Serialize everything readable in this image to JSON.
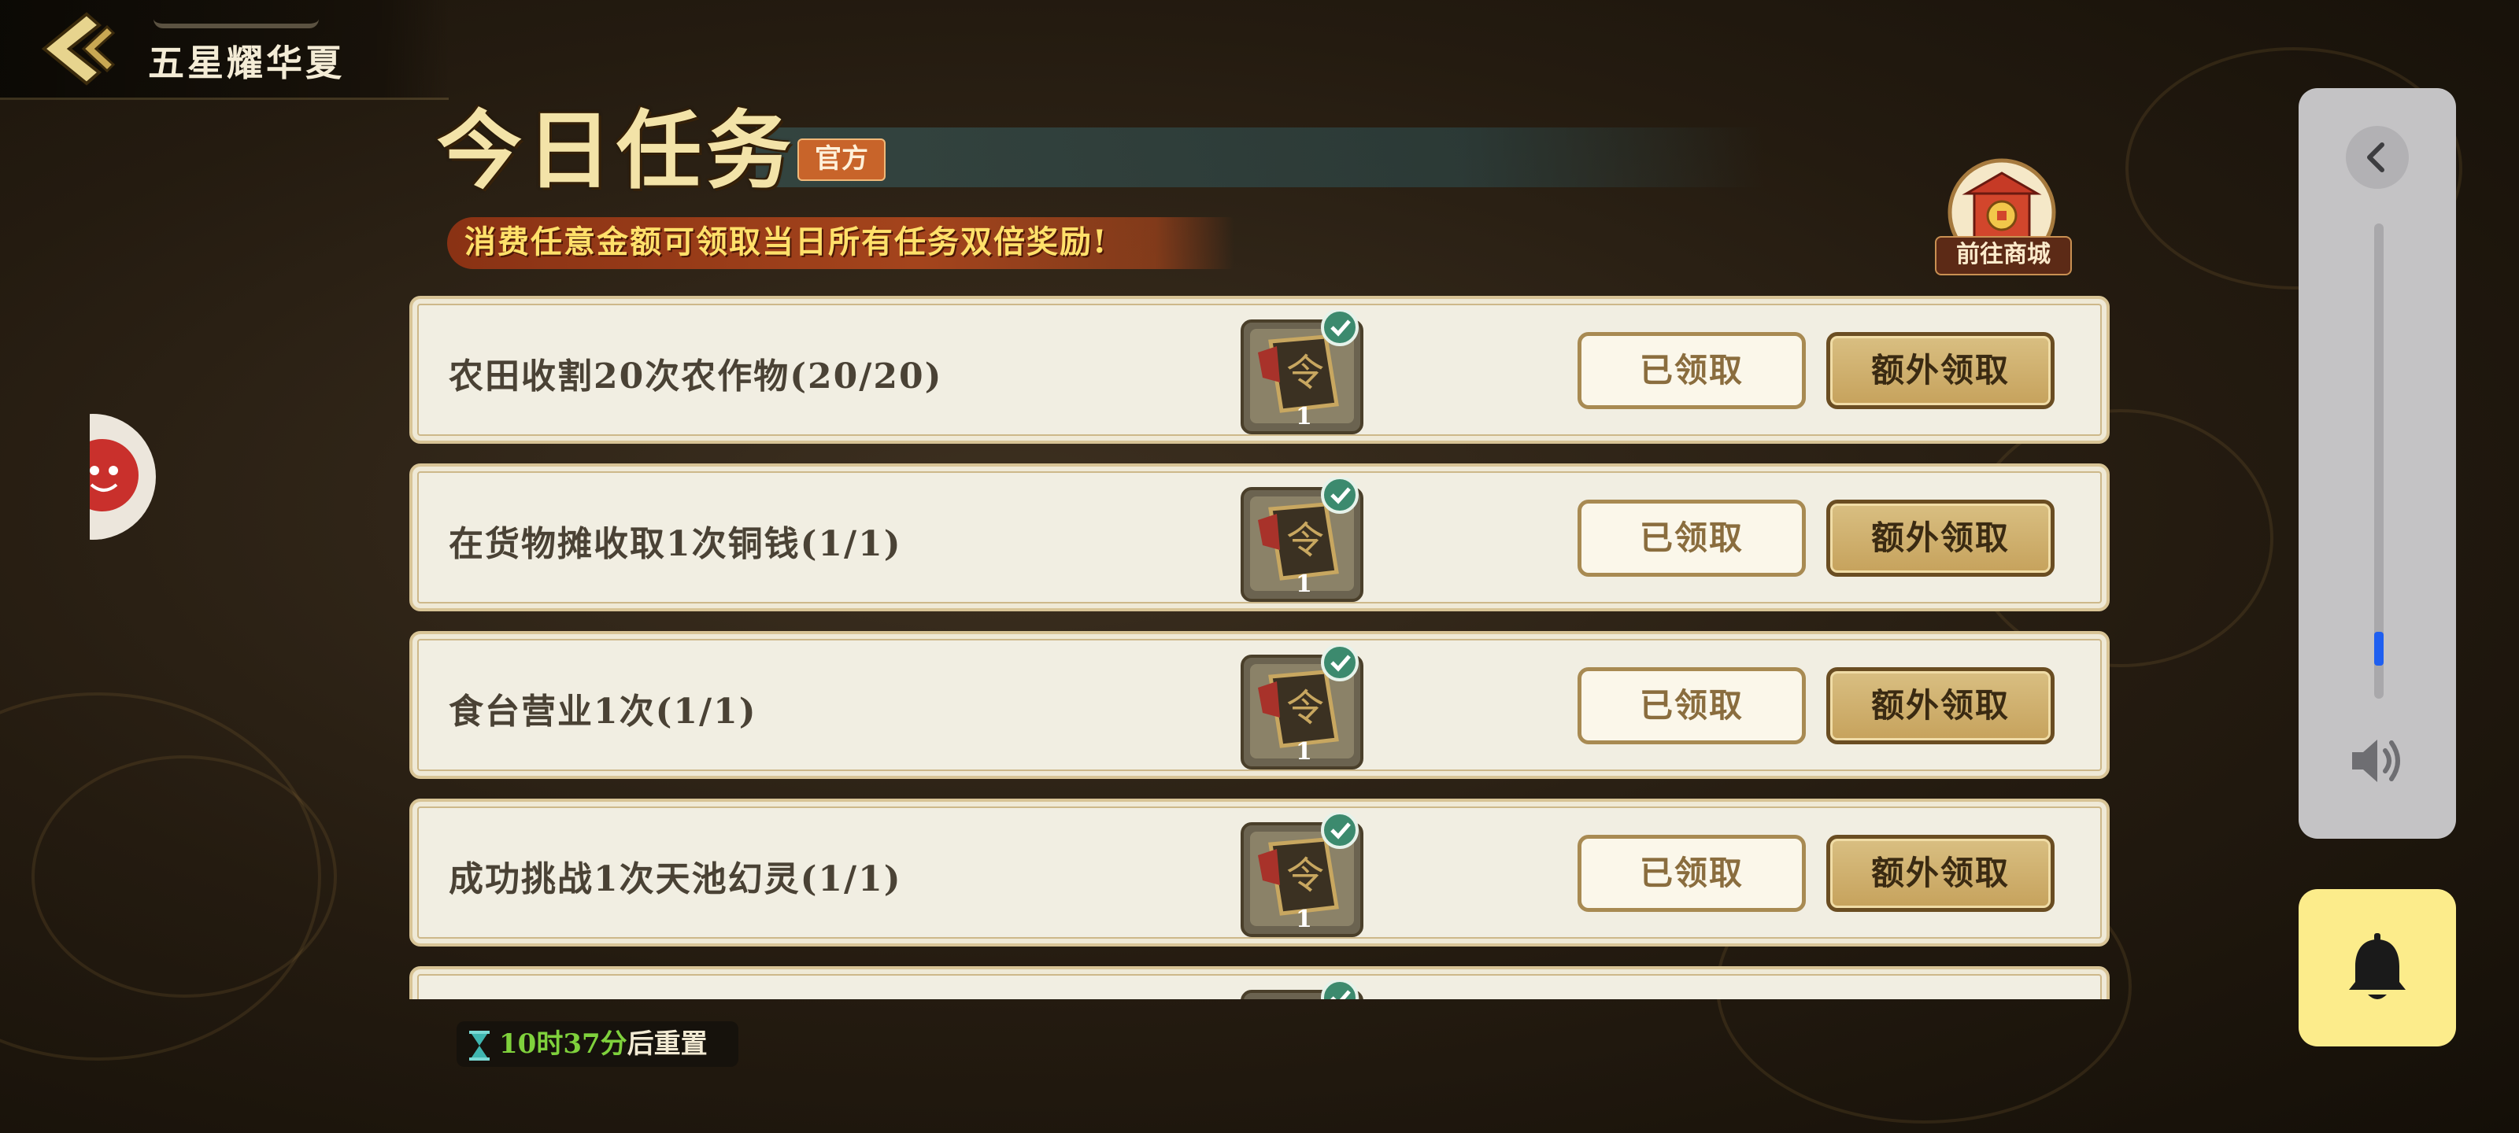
{
  "header": {
    "game_title": "五星耀华夏",
    "back_icon": "chevron-left-icon"
  },
  "tasks_panel": {
    "title": "今日任务",
    "official_badge": "官方",
    "promo_text": "消费任意金额可领取当日所有任务双倍奖励!",
    "shop_button_label": "前往商城",
    "claimed_label": "已领取",
    "extra_claim_label": "额外领取",
    "items": [
      {
        "name": "农田收割20次农作物(20/20)",
        "reward_count": "1",
        "completed": true
      },
      {
        "name": "在货物摊收取1次铜钱(1/1)",
        "reward_count": "1",
        "completed": true
      },
      {
        "name": "食台营业1次(1/1)",
        "reward_count": "1",
        "completed": true
      },
      {
        "name": "成功挑战1次天池幻灵(1/1)",
        "reward_count": "1",
        "completed": true
      }
    ],
    "reset": {
      "time": "10时37分",
      "suffix": "后重置"
    }
  },
  "system_volume": {
    "level": 0.07,
    "collapse_icon": "chevron-left-icon",
    "speaker_icon": "speaker-icon",
    "bell_icon": "bell-icon"
  },
  "colors": {
    "accent_gold": "#c6a25c",
    "promo_text": "#ffe06a",
    "timer_green": "#7fd13c",
    "volume_fill": "#1f5ff0",
    "bell_bg": "#fcec8b"
  }
}
